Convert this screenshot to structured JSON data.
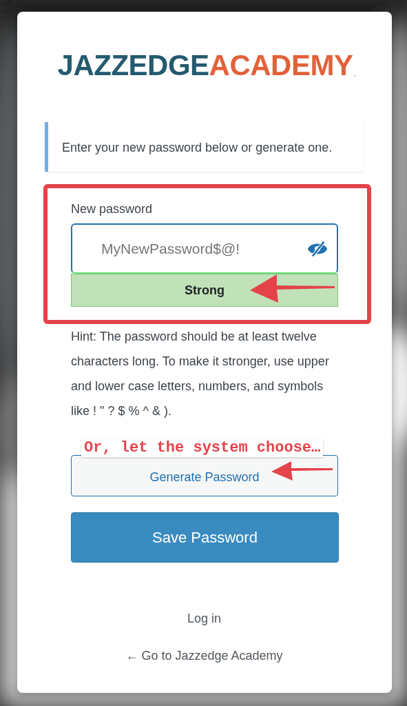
{
  "logo": {
    "part_1": "JAZZEDGE",
    "part_2": "ACADEMY",
    "mark": "™"
  },
  "notice": {
    "text": "Enter your new password below or generate one."
  },
  "password_field": {
    "label": "New password",
    "value": "MyNewPassword$@!",
    "visible": true
  },
  "strength": {
    "text": "Strong",
    "kind": "strong"
  },
  "hint": "Hint: The password should be at least twelve characters long. To make it stronger, use upper and lower case letters, numbers, and symbols like ! \" ? $ % ^ & ).",
  "buttons": [
    {
      "label": "Generate Password",
      "kind": "secondary"
    },
    {
      "label": "Save Password",
      "kind": "primary"
    }
  ],
  "links": [
    {
      "label": "Log in"
    },
    {
      "label": "← Go to Jazzedge Academy"
    }
  ],
  "annotations": [
    {
      "kind": "frame"
    },
    {
      "kind": "arrow"
    },
    {
      "kind": "callout",
      "text": "Or, let the system choose…"
    },
    {
      "kind": "arrow"
    }
  ]
}
